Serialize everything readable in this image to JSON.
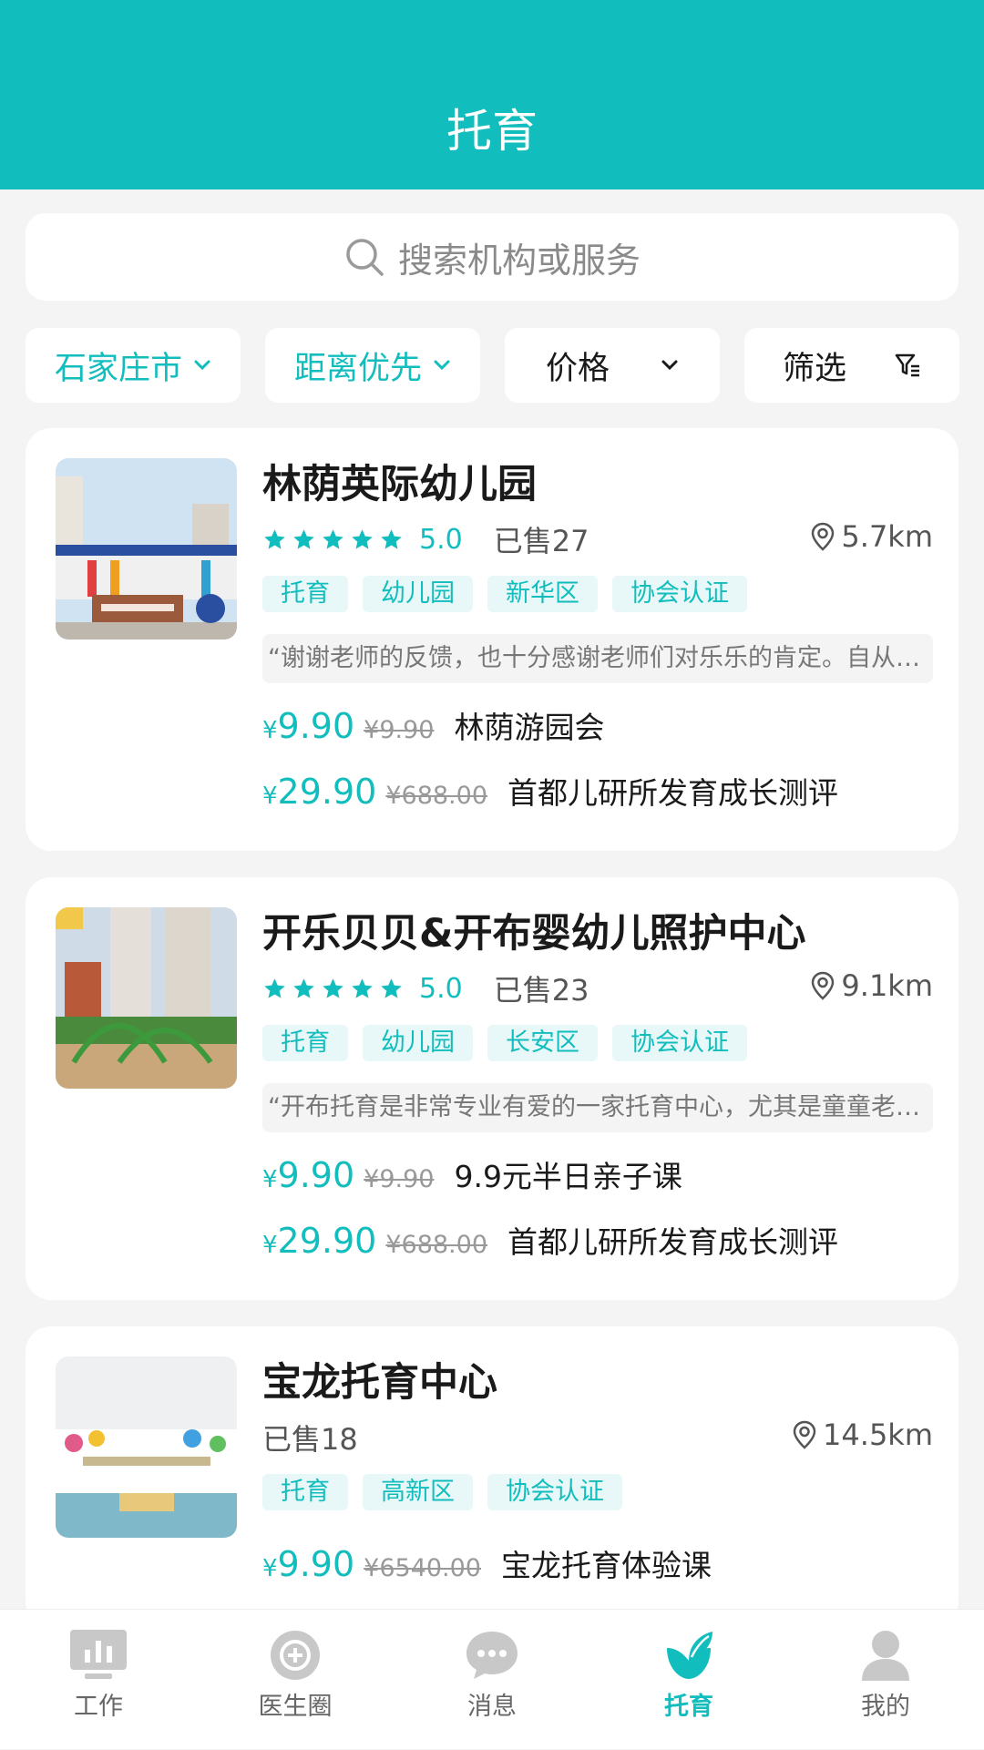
{
  "header": {
    "title": "托育"
  },
  "search": {
    "placeholder": "搜索机构或服务"
  },
  "filters": [
    {
      "label": "石家庄市",
      "active": true
    },
    {
      "label": "距离优先",
      "active": true
    },
    {
      "label": "价格",
      "active": false
    },
    {
      "label": "筛选",
      "active": false
    }
  ],
  "cards": [
    {
      "name": "林荫英际幼儿园",
      "rating": "5.0",
      "stars": 5,
      "sold": "已售27",
      "distance": "5.7km",
      "tags": [
        "托育",
        "幼儿园",
        "新华区",
        "协会认证"
      ],
      "review": "“谢谢老师的反馈，也十分感谢老师们对乐乐的肯定。自从…",
      "offers": [
        {
          "currency": "¥",
          "price": "9.90",
          "original": "¥9.90",
          "name": "林荫游园会"
        },
        {
          "currency": "¥",
          "price": "29.90",
          "original": "¥688.00",
          "name": "首都儿研所发育成长测评"
        }
      ]
    },
    {
      "name": "开乐贝贝&开布婴幼儿照护中心",
      "rating": "5.0",
      "stars": 5,
      "sold": "已售23",
      "distance": "9.1km",
      "tags": [
        "托育",
        "幼儿园",
        "长安区",
        "协会认证"
      ],
      "review": "“开布托育是非常专业有爱的一家托育中心，尤其是童童老…",
      "offers": [
        {
          "currency": "¥",
          "price": "9.90",
          "original": "¥9.90",
          "name": "9.9元半日亲子课"
        },
        {
          "currency": "¥",
          "price": "29.90",
          "original": "¥688.00",
          "name": "首都儿研所发育成长测评"
        }
      ]
    },
    {
      "name": "宝龙托育中心",
      "sold": "已售18",
      "distance": "14.5km",
      "tags": [
        "托育",
        "高新区",
        "协会认证"
      ],
      "offers": [
        {
          "currency": "¥",
          "price": "9.90",
          "original": "¥6540.00",
          "name": "宝龙托育体验课"
        }
      ]
    }
  ],
  "tabbar": [
    {
      "label": "工作",
      "icon": "monitor-chart-icon",
      "active": false
    },
    {
      "label": "医生圈",
      "icon": "doctor-circle-icon",
      "active": false
    },
    {
      "label": "消息",
      "icon": "chat-bubble-icon",
      "active": false
    },
    {
      "label": "托育",
      "icon": "sprout-icon",
      "active": true
    },
    {
      "label": "我的",
      "icon": "user-icon",
      "active": false
    }
  ],
  "colors": {
    "accent": "#12bdbd",
    "tag_bg": "#e8f8f8",
    "page_bg": "#f4f4f4",
    "inactive_icon": "#c8c8c8"
  }
}
